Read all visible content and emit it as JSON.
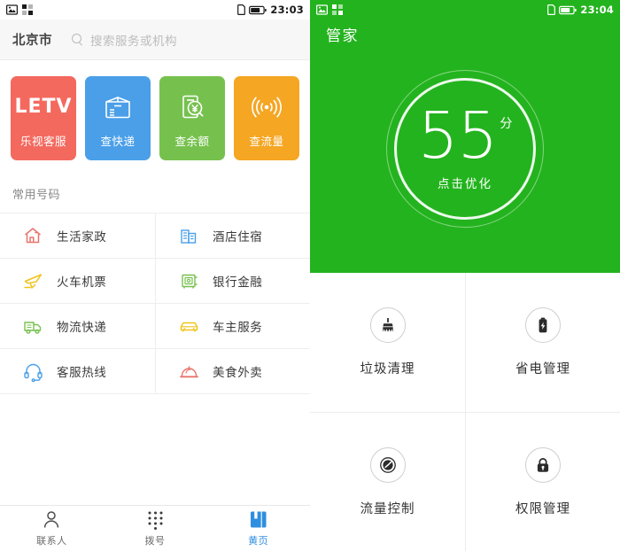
{
  "left_screen": {
    "status_bar": {
      "icons": [
        "image-icon",
        "qr-grid-icon"
      ],
      "sim_icon": "sim-card-icon",
      "battery_icon": "battery-icon",
      "time": "23:03"
    },
    "search": {
      "city": "北京市",
      "search_icon": "search-icon",
      "placeholder": "搜索服务或机构"
    },
    "tiles": [
      {
        "label": "乐视客服",
        "icon": "letv-wordmark",
        "word": "LETV",
        "color": "#f4695e"
      },
      {
        "label": "查快递",
        "icon": "package-box-icon",
        "color": "#4a9fe8"
      },
      {
        "label": "查余额",
        "icon": "yuan-balance-icon",
        "color": "#76c14e"
      },
      {
        "label": "查流量",
        "icon": "signal-waves-icon",
        "color": "#f5a623"
      }
    ],
    "section_title": "常用号码",
    "categories": [
      {
        "label": "生活家政",
        "icon": "house-icon",
        "color": "#e8756b"
      },
      {
        "label": "酒店住宿",
        "icon": "hotel-building-icon",
        "color": "#4a9fe8"
      },
      {
        "label": "火车机票",
        "icon": "airplane-icon",
        "color": "#f0c419"
      },
      {
        "label": "银行金融",
        "icon": "bank-safe-icon",
        "color": "#76c14e"
      },
      {
        "label": "物流快递",
        "icon": "delivery-truck-icon",
        "color": "#76c14e"
      },
      {
        "label": "车主服务",
        "icon": "car-icon",
        "color": "#f0c419"
      },
      {
        "label": "客服热线",
        "icon": "headset-icon",
        "color": "#4a9fe8"
      },
      {
        "label": "美食外卖",
        "icon": "food-cloche-icon",
        "color": "#e8756b"
      }
    ],
    "bottom_nav": {
      "active_color": "#2f8ee0",
      "items": [
        {
          "label": "联系人",
          "icon": "person-icon",
          "active": false
        },
        {
          "label": "拨号",
          "icon": "dialpad-icon",
          "active": false
        },
        {
          "label": "黄页",
          "icon": "yellow-pages-book-icon",
          "active": true
        }
      ]
    }
  },
  "right_screen": {
    "status_bar": {
      "icons": [
        "image-icon",
        "qr-grid-icon"
      ],
      "sim_icon": "sim-card-icon",
      "battery_icon": "battery-icon",
      "time": "23:04"
    },
    "app_title": "管家",
    "hero": {
      "background_color": "#23b31e",
      "score": "55",
      "score_unit": "分",
      "cta": "点击优化"
    },
    "features": [
      {
        "label": "垃圾清理",
        "icon": "broom-clean-icon"
      },
      {
        "label": "省电管理",
        "icon": "battery-bolt-icon"
      },
      {
        "label": "流量控制",
        "icon": "data-gauge-icon"
      },
      {
        "label": "权限管理",
        "icon": "lock-icon"
      }
    ]
  }
}
